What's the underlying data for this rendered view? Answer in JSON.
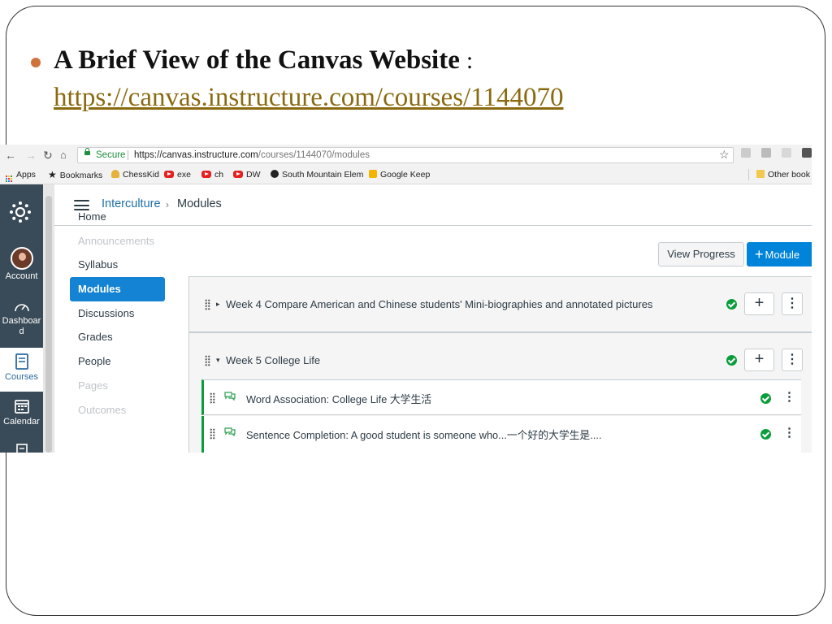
{
  "slide": {
    "title": "A Brief View of the Canvas Website",
    "title_colon": ":",
    "link": "https://canvas.instructure.com/courses/1144070"
  },
  "browser": {
    "secure_label": "Secure",
    "url_host": "https://canvas.instructure.com",
    "url_path": "/courses/1144070/modules",
    "bookmarks": [
      "Apps",
      "Bookmarks",
      "ChessKid",
      "exe",
      "ch",
      "DW",
      "South Mountain Elem",
      "Google Keep",
      "Other book"
    ]
  },
  "global_nav": {
    "items": [
      {
        "label": "Account",
        "icon": "avatar"
      },
      {
        "label": "Dashboar",
        "label2": "d",
        "icon": "dashboard-icon"
      },
      {
        "label": "Courses",
        "icon": "courses-icon",
        "active": true
      },
      {
        "label": "Calendar",
        "icon": "calendar-icon"
      }
    ]
  },
  "header": {
    "course_name": "Interculture",
    "current_page": "Modules"
  },
  "course_nav": {
    "items": [
      {
        "label": "Home",
        "state": "normal"
      },
      {
        "label": "Announcements",
        "state": "disabled"
      },
      {
        "label": "Syllabus",
        "state": "normal"
      },
      {
        "label": "Modules",
        "state": "active"
      },
      {
        "label": "Discussions",
        "state": "normal"
      },
      {
        "label": "Grades",
        "state": "normal"
      },
      {
        "label": "People",
        "state": "normal"
      },
      {
        "label": "Pages",
        "state": "disabled"
      },
      {
        "label": "Outcomes",
        "state": "disabled"
      }
    ]
  },
  "toolbar": {
    "view_progress_label": "View Progress",
    "add_module_label": "Module"
  },
  "modules": [
    {
      "title": "Week 4 Compare American and Chinese students' Mini-biographies and annotated pictures",
      "collapsed": true,
      "published": true
    },
    {
      "title": "Week 5 College Life",
      "collapsed": false,
      "published": true,
      "items": [
        {
          "title": "Word Association: College Life 大学生活",
          "type": "discussion",
          "published": true
        },
        {
          "title": "Sentence Completion: A good student is someone who...一个好的大学生是....",
          "type": "discussion",
          "published": true
        }
      ]
    }
  ],
  "colors": {
    "global_nav_bg": "#394b58",
    "accent_blue": "#0084d9",
    "published_green": "#0b9d3b",
    "slide_bullet": "#d0733a",
    "slide_link": "#8a6a10"
  }
}
